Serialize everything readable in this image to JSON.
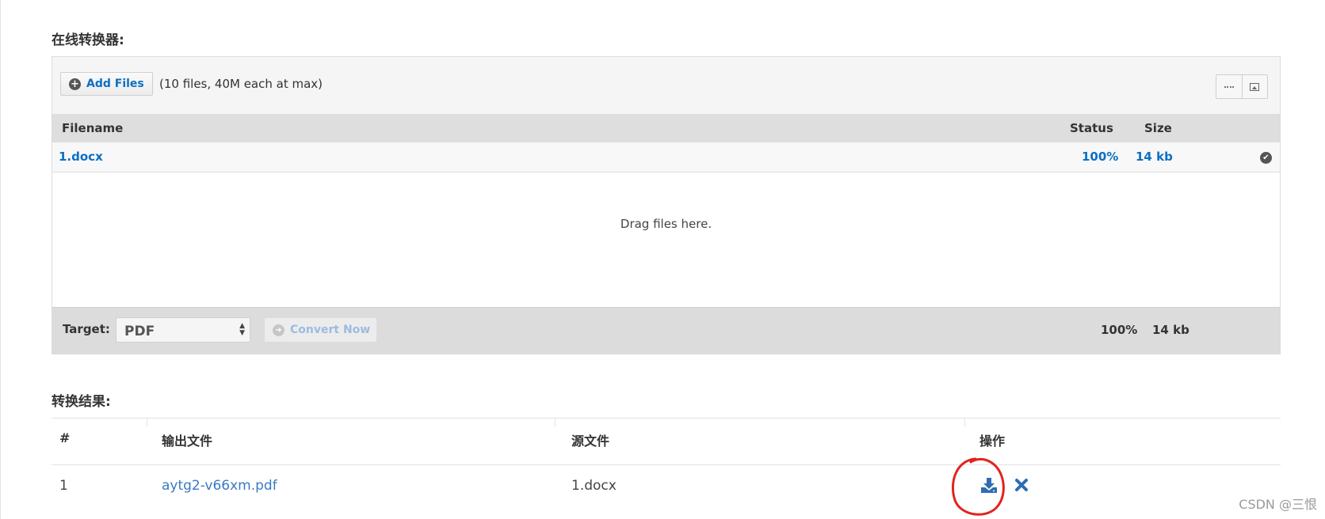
{
  "sections": {
    "converter_title": "在线转换器:",
    "results_title": "转换结果:"
  },
  "uploader": {
    "add_files_label": "Add Files",
    "limit_text": "(10 files, 40M each at max)",
    "view_toggle": [
      "list-view-icon",
      "thumbnail-view-icon"
    ],
    "columns": {
      "filename": "Filename",
      "status": "Status",
      "size": "Size"
    },
    "files": [
      {
        "name": "1.docx",
        "status": "100%",
        "size": "14 kb"
      }
    ],
    "drop_text": "Drag files here.",
    "footer": {
      "target_label": "Target:",
      "target_value": "PDF",
      "convert_label": "Convert Now",
      "total_status": "100%",
      "total_size": "14 kb"
    }
  },
  "results": {
    "columns": [
      "#",
      "输出文件",
      "源文件",
      "操作"
    ],
    "rows": [
      {
        "index": "1",
        "output": "aytg2-v66xm.pdf",
        "source": "1.docx",
        "actions": [
          "download-icon",
          "delete-icon"
        ]
      }
    ]
  },
  "watermark": "CSDN @三恨",
  "colors": {
    "link": "#0b6fc4",
    "accent_circle": "#e0241e",
    "action_icon": "#2f6db3"
  }
}
